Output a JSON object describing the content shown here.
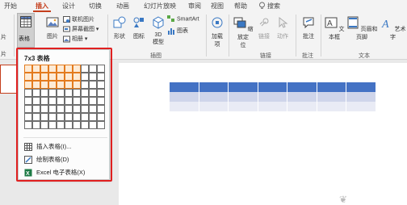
{
  "tabs": [
    {
      "label": "开始",
      "active": false
    },
    {
      "label": "插入",
      "active": true
    },
    {
      "label": "设计",
      "active": false
    },
    {
      "label": "切换",
      "active": false
    },
    {
      "label": "动画",
      "active": false
    },
    {
      "label": "幻灯片放映",
      "active": false
    },
    {
      "label": "审阅",
      "active": false
    },
    {
      "label": "视图",
      "active": false
    },
    {
      "label": "帮助",
      "active": false
    }
  ],
  "search_label": "搜索",
  "ribbon": {
    "left_cut_label": "片",
    "left_cut_label2": "片",
    "table_label": "表格",
    "picture_label": "图片",
    "online_picture": "联机图片",
    "screenshot": "屏幕截图",
    "album": "相册",
    "shapes": "形状",
    "icons": "图标",
    "model3d_line1": "3D",
    "model3d_line2": "模型",
    "smartart": "SmartArt",
    "chart": "图表",
    "addins_line1": "加载",
    "addins_line2": "项",
    "zoom_line1": "缩放定",
    "zoom_line2": "位",
    "link": "链接",
    "action": "动作",
    "comment": "批注",
    "textbox": "文本框",
    "header_footer": "页眉和页脚",
    "wordart": "艺术字",
    "groups": {
      "illustrations": "插图",
      "links": "链接",
      "comments": "批注",
      "text": "文本"
    }
  },
  "dropdown": {
    "title": "7x3 表格",
    "selected_cols": 7,
    "selected_rows": 3,
    "grid_cols": 10,
    "grid_rows": 8,
    "items": [
      {
        "label": "插入表格(I)...",
        "icon": "insert-table-icon"
      },
      {
        "label": "绘制表格(D)",
        "icon": "draw-table-icon"
      },
      {
        "label": "Excel 电子表格(X)",
        "icon": "excel-icon"
      }
    ]
  },
  "colors": {
    "accent": "#c43e1c",
    "highlight": "#e02020",
    "grid_selected_border": "#e37b1e",
    "table_header": "#4472c4",
    "table_band1": "#cfd5ea",
    "table_band2": "#e9ebf5"
  },
  "slide_table": {
    "cols": 7,
    "rows": 3
  }
}
